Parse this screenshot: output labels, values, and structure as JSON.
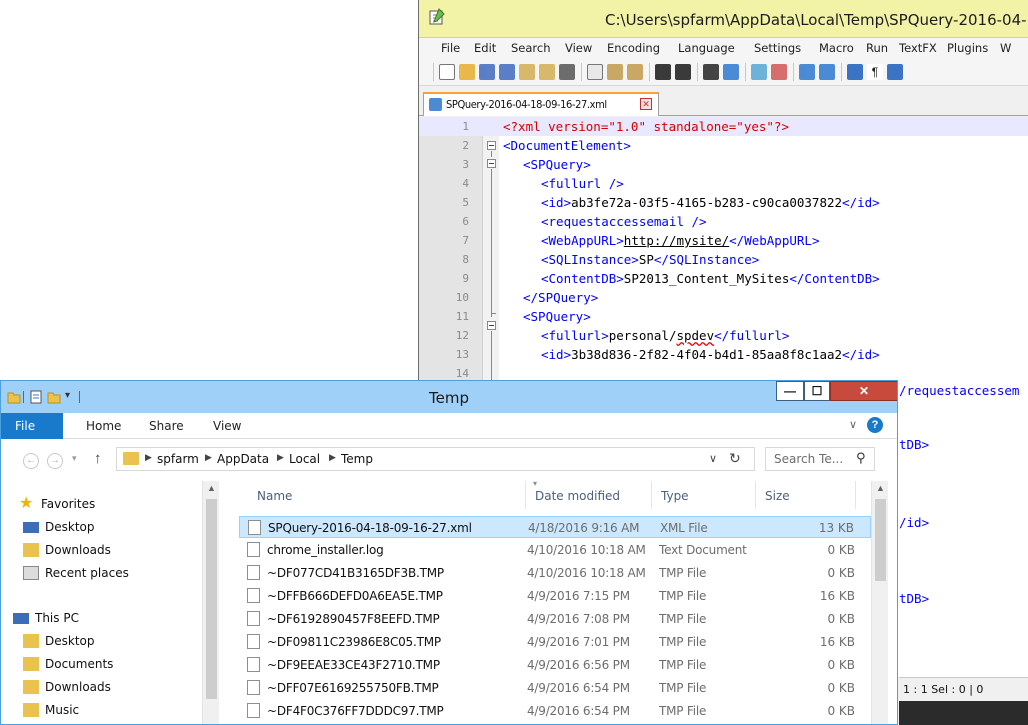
{
  "notepad": {
    "title": "C:\\Users\\spfarm\\AppData\\Local\\Temp\\SPQuery-2016-04-",
    "menu": [
      "File",
      "Edit",
      "Search",
      "View",
      "Encoding",
      "Language",
      "Settings",
      "Macro",
      "Run",
      "TextFX",
      "Plugins",
      "W"
    ],
    "tab_label": "SPQuery-2016-04-18-09-16-27.xml",
    "line_numbers": [
      "1",
      "2",
      "3",
      "4",
      "5",
      "6",
      "7",
      "8",
      "9",
      "10",
      "11",
      "12",
      "13",
      "14"
    ],
    "code": {
      "l1_pi": "<?xml version=\"1.0\" standalone=\"yes\"?>",
      "l2": "<DocumentElement>",
      "l3": "<SPQuery>",
      "l4": "<fullurl />",
      "l5_open": "<id>",
      "l5_text": "ab3fe72a-03f5-4165-b283-c90ca0037822",
      "l5_close": "</id>",
      "l6": "<requestaccessemail />",
      "l7_open": "<WebAppURL>",
      "l7_text": "http://mysite/",
      "l7_close": "</WebAppURL>",
      "l8_open": "<SQLInstance>",
      "l8_text": "SP",
      "l8_close": "</SQLInstance>",
      "l9_open": "<ContentDB>",
      "l9_text": "SP2013_Content_MySites",
      "l9_close": "</ContentDB>",
      "l10": "</SPQuery>",
      "l11": "<SPQuery>",
      "l12_open": "<fullurl>",
      "l12_text1": "personal/",
      "l12_text2": "spdev",
      "l12_close": "</fullurl>",
      "l13_open": "<id>",
      "l13_text": "3b38d836-2f82-4f04-b4d1-85aa8f8c1aa2",
      "l13_close": "</id>",
      "r14": "/requestaccessem",
      "r_a": "tDB>",
      "r_b": "/id>",
      "r_c": "tDB>"
    },
    "status": "1 : 1   Sel : 0 | 0"
  },
  "explorer": {
    "title": "Temp",
    "ribbon": {
      "file": "File",
      "home": "Home",
      "share": "Share",
      "view": "View"
    },
    "breadcrumb": [
      "spfarm",
      "AppData",
      "Local",
      "Temp"
    ],
    "search_placeholder": "Search Te...",
    "nav": {
      "favorites": "Favorites",
      "fav_items": [
        "Desktop",
        "Downloads",
        "Recent places"
      ],
      "this_pc": "This PC",
      "pc_items": [
        "Desktop",
        "Documents",
        "Downloads",
        "Music"
      ]
    },
    "columns": {
      "name": "Name",
      "date": "Date modified",
      "type": "Type",
      "size": "Size"
    },
    "files": [
      {
        "name": "SPQuery-2016-04-18-09-16-27.xml",
        "date": "4/18/2016 9:16 AM",
        "type": "XML File",
        "size": "13 KB"
      },
      {
        "name": "chrome_installer.log",
        "date": "4/10/2016 10:18 AM",
        "type": "Text Document",
        "size": "0 KB"
      },
      {
        "name": "~DF077CD41B3165DF3B.TMP",
        "date": "4/10/2016 10:18 AM",
        "type": "TMP File",
        "size": "0 KB"
      },
      {
        "name": "~DFFB666DEFD0A6EA5E.TMP",
        "date": "4/9/2016 7:15 PM",
        "type": "TMP File",
        "size": "16 KB"
      },
      {
        "name": "~DF6192890457F8EEFD.TMP",
        "date": "4/9/2016 7:08 PM",
        "type": "TMP File",
        "size": "0 KB"
      },
      {
        "name": "~DF09811C23986E8C05.TMP",
        "date": "4/9/2016 7:01 PM",
        "type": "TMP File",
        "size": "16 KB"
      },
      {
        "name": "~DF9EEAE33CE43F2710.TMP",
        "date": "4/9/2016 6:56 PM",
        "type": "TMP File",
        "size": "0 KB"
      },
      {
        "name": "~DFF07E6169255750FB.TMP",
        "date": "4/9/2016 6:54 PM",
        "type": "TMP File",
        "size": "0 KB"
      },
      {
        "name": "~DF4F0C376FF7DDDC97.TMP",
        "date": "4/9/2016 6:54 PM",
        "type": "TMP File",
        "size": "0 KB"
      }
    ]
  }
}
